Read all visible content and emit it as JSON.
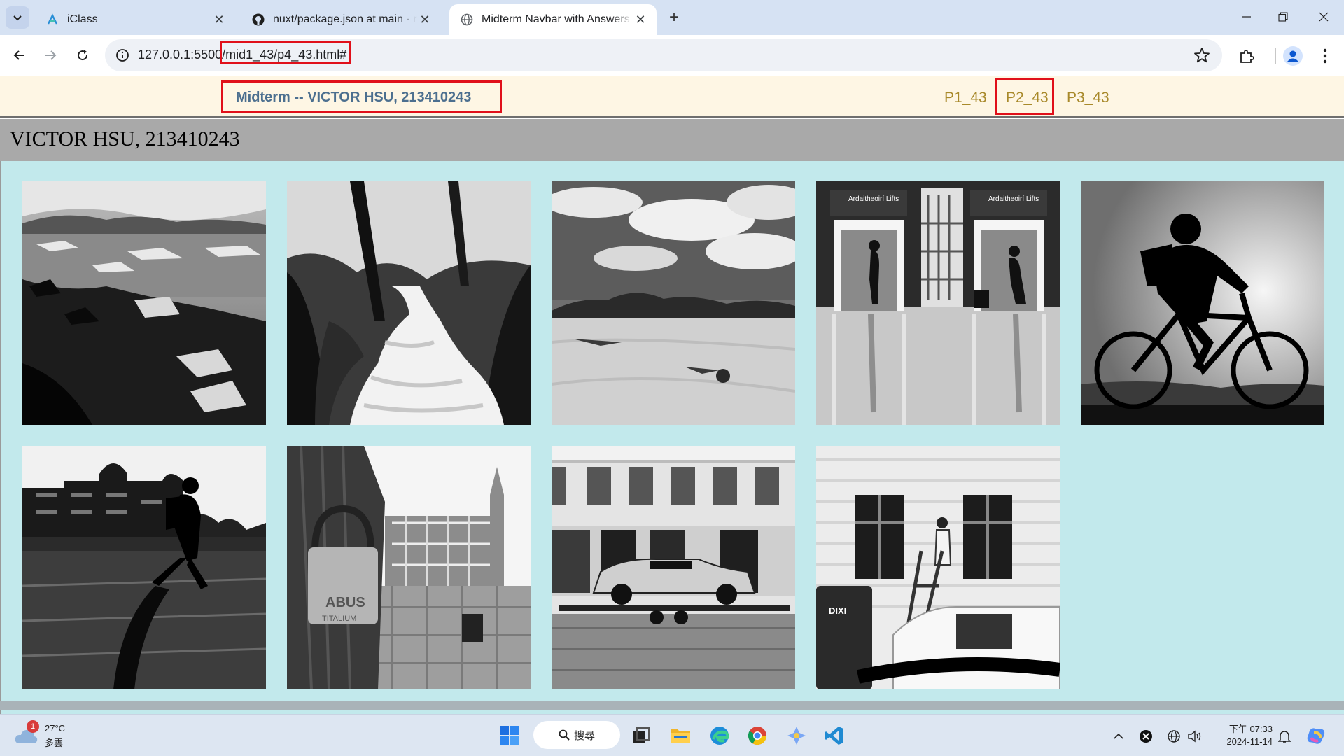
{
  "browser": {
    "tabs": [
      {
        "title": "iClass",
        "active": false
      },
      {
        "title": "nuxt/package.json at main · nuxt/nuxt",
        "active": false
      },
      {
        "title": "Midterm Navbar with Answers",
        "active": true
      }
    ],
    "url": {
      "host": "127.0.0.1:5500",
      "path": "/mid1_43/p4_43.html#"
    },
    "new_tab_label": "+"
  },
  "page": {
    "brand": "Midterm -- VICTOR HSU, 213410243",
    "nav_links": [
      "P1_43",
      "P2_43",
      "P3_43"
    ],
    "banner_title": "VICTOR HSU, 213410243",
    "photos": [
      "glacier-lagoon-photo",
      "waterfall-photo",
      "desert-dunes-photo",
      "elevator-lifts-photo",
      "cyclist-silhouette-photo",
      "man-walking-photo",
      "padlock-street-photo",
      "classic-car-trailer-photo",
      "worker-ladder-photo"
    ],
    "photo_texts": {
      "lifts_sign": "Ardaitheoirí Lifts",
      "padlock_brand": "ABUS",
      "padlock_model": "TITALIUM",
      "toilet_brand": "DIXI"
    }
  },
  "taskbar": {
    "weather_temp": "27°C",
    "weather_desc": "多雲",
    "weather_badge": "1",
    "search_label": "搜尋",
    "time": "下午 07:33",
    "date": "2024-11-14"
  },
  "colors": {
    "highlight": "#e0101a",
    "nav_bg": "#fef6e4",
    "gallery_bg": "#c2e9ec",
    "banner_bg": "#a9a9a9"
  }
}
